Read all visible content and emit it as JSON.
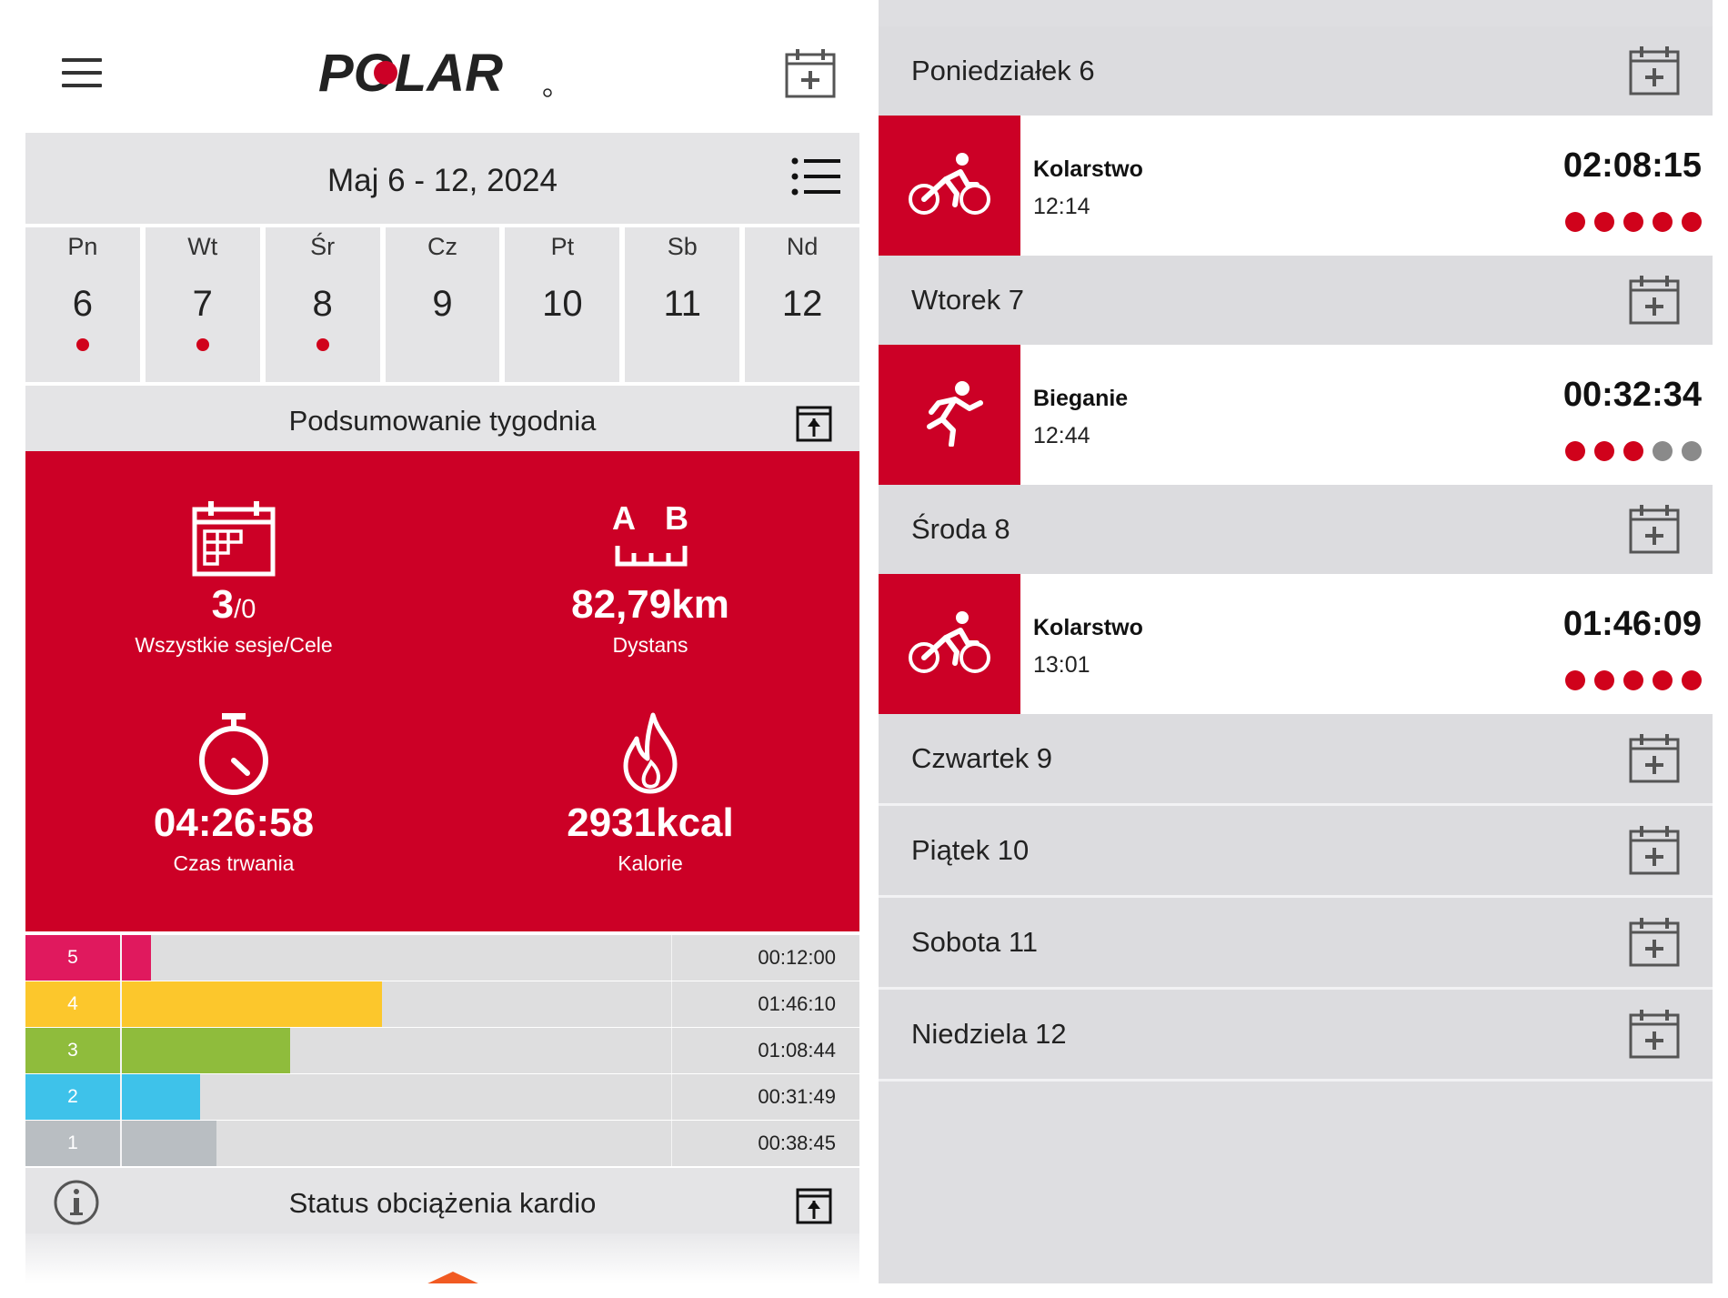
{
  "colors": {
    "brand_red": "#cc0026",
    "dot_red": "#d0021b",
    "dot_grey": "#8a8a8a",
    "panel_grey": "#e4e4e6"
  },
  "left": {
    "header": {
      "logo_text": "POLAR",
      "menu_icon": "hamburger-icon",
      "add_icon": "calendar-plus-icon"
    },
    "week": {
      "label": "Maj 6 - 12, 2024",
      "view_icon": "list-icon"
    },
    "days": [
      {
        "name": "Pn",
        "date": "6",
        "has_activity": true
      },
      {
        "name": "Wt",
        "date": "7",
        "has_activity": true
      },
      {
        "name": "Śr",
        "date": "8",
        "has_activity": true
      },
      {
        "name": "Cz",
        "date": "9",
        "has_activity": false
      },
      {
        "name": "Pt",
        "date": "10",
        "has_activity": false
      },
      {
        "name": "Sb",
        "date": "11",
        "has_activity": false
      },
      {
        "name": "Nd",
        "date": "12",
        "has_activity": false
      }
    ],
    "summary": {
      "title": "Podsumowanie tygodnia",
      "sessions_value": "3",
      "sessions_goal": "/0",
      "sessions_label": "Wszystkie sesje/Cele",
      "distance_value": "82,79km",
      "distance_label": "Dystans",
      "distance_icon_a": "A",
      "distance_icon_b": "B",
      "duration_value": "04:26:58",
      "duration_label": "Czas trwania",
      "calories_value": "2931kcal",
      "calories_label": "Kalorie"
    },
    "zones": [
      {
        "zone": "5",
        "time": "00:12:00",
        "seconds": 720,
        "color": "#e0195e"
      },
      {
        "zone": "4",
        "time": "01:46:10",
        "seconds": 6370,
        "color": "#fcc72c"
      },
      {
        "zone": "3",
        "time": "01:08:44",
        "seconds": 4124,
        "color": "#8fbc3c"
      },
      {
        "zone": "2",
        "time": "00:31:49",
        "seconds": 1909,
        "color": "#3ec2ea"
      },
      {
        "zone": "1",
        "time": "00:38:45",
        "seconds": 2325,
        "color": "#b9bec2"
      }
    ],
    "cardio": {
      "title": "Status obciążenia kardio",
      "info_icon": "info-icon"
    }
  },
  "right": {
    "days": [
      {
        "label": "Poniedziałek 6",
        "sessions": [
          {
            "sport": "Kolarstwo",
            "icon": "cycling-icon",
            "start": "12:14",
            "duration": "02:08:15",
            "dots_filled": 5
          }
        ]
      },
      {
        "label": "Wtorek 7",
        "sessions": [
          {
            "sport": "Bieganie",
            "icon": "running-icon",
            "start": "12:44",
            "duration": "00:32:34",
            "dots_filled": 3
          }
        ]
      },
      {
        "label": "Środa 8",
        "sessions": [
          {
            "sport": "Kolarstwo",
            "icon": "cycling-icon",
            "start": "13:01",
            "duration": "01:46:09",
            "dots_filled": 5
          }
        ]
      },
      {
        "label": "Czwartek 9",
        "sessions": []
      },
      {
        "label": "Piątek 10",
        "sessions": []
      },
      {
        "label": "Sobota 11",
        "sessions": []
      },
      {
        "label": "Niedziela 12",
        "sessions": []
      }
    ]
  }
}
